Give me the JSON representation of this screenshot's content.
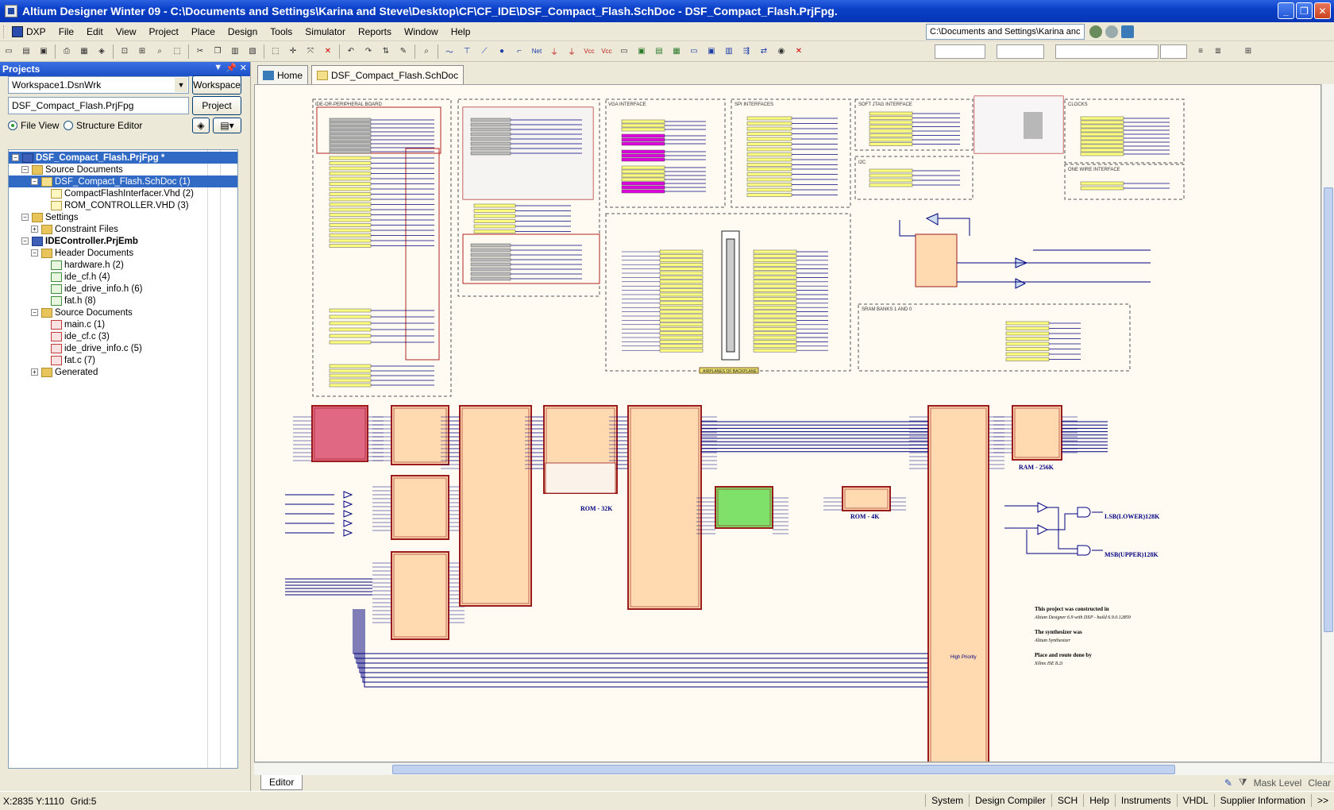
{
  "window": {
    "title": "Altium Designer Winter 09 - C:\\Documents and Settings\\Karina and Steve\\Desktop\\CF\\CF_IDE\\DSF_Compact_Flash.SchDoc - DSF_Compact_Flash.PrjFpg.",
    "min": "_",
    "max": "❐",
    "close": "✕"
  },
  "menu": {
    "items": [
      "DXP",
      "File",
      "Edit",
      "View",
      "Project",
      "Place",
      "Design",
      "Tools",
      "Simulator",
      "Reports",
      "Window",
      "Help"
    ],
    "path": "C:\\Documents and Settings\\Karina anc"
  },
  "projects_panel": {
    "title": "Projects",
    "workspace_value": "Workspace1.DsnWrk",
    "workspace_btn": "Workspace",
    "project_value": "DSF_Compact_Flash.PrjFpg",
    "project_btn": "Project",
    "file_view": "File View",
    "structure_editor": "Structure Editor",
    "tree": [
      {
        "label": "DSF_Compact_Flash.PrjFpg *",
        "level": 0,
        "exp": "-",
        "icon": "proj",
        "bold": true,
        "selected": true
      },
      {
        "label": "Source Documents",
        "level": 1,
        "exp": "-",
        "icon": "folder"
      },
      {
        "label": "DSF_Compact_Flash.SchDoc (1)",
        "level": 2,
        "exp": "-",
        "icon": "sch",
        "selected": true
      },
      {
        "label": "CompactFlashInterfacer.Vhd (2)",
        "level": 3,
        "exp": "",
        "icon": "vhd"
      },
      {
        "label": "ROM_CONTROLLER.VHD (3)",
        "level": 3,
        "exp": "",
        "icon": "vhd"
      },
      {
        "label": "Settings",
        "level": 1,
        "exp": "-",
        "icon": "folder"
      },
      {
        "label": "Constraint Files",
        "level": 2,
        "exp": "+",
        "icon": "folder"
      },
      {
        "label": "IDEController.PrjEmb",
        "level": 1,
        "exp": "-",
        "icon": "proj",
        "bold": true
      },
      {
        "label": "Header Documents",
        "level": 2,
        "exp": "-",
        "icon": "folder"
      },
      {
        "label": "hardware.h (2)",
        "level": 3,
        "exp": "",
        "icon": "h"
      },
      {
        "label": "ide_cf.h (4)",
        "level": 3,
        "exp": "",
        "icon": "h"
      },
      {
        "label": "ide_drive_info.h (6)",
        "level": 3,
        "exp": "",
        "icon": "h"
      },
      {
        "label": "fat.h (8)",
        "level": 3,
        "exp": "",
        "icon": "h"
      },
      {
        "label": "Source Documents",
        "level": 2,
        "exp": "-",
        "icon": "folder"
      },
      {
        "label": "main.c (1)",
        "level": 3,
        "exp": "",
        "icon": "c"
      },
      {
        "label": "ide_cf.c (3)",
        "level": 3,
        "exp": "",
        "icon": "c"
      },
      {
        "label": "ide_drive_info.c (5)",
        "level": 3,
        "exp": "",
        "icon": "c"
      },
      {
        "label": "fat.c (7)",
        "level": 3,
        "exp": "",
        "icon": "c"
      },
      {
        "label": "Generated",
        "level": 2,
        "exp": "+",
        "icon": "folder"
      }
    ]
  },
  "doc_tabs": [
    "Home",
    "DSF_Compact_Flash.SchDoc"
  ],
  "schematic": {
    "sections": {
      "ide": "IDE-OR-PERIPHERAL BOARD",
      "vga": "VGA INTERFACE",
      "spi": "SPI INTERFACES",
      "jtag": "SOFT JTAG INTERFACE",
      "clocks": "CLOCKS",
      "i2c": "I2C",
      "onewire": "ONE WIRE INTERFACE",
      "sram": "SRAM BANKS 1 AND 0",
      "backplane": "AIRPLANES OF BACKPLANE"
    },
    "labels": {
      "rom32": "ROM - 32K",
      "rom4": "ROM - 4K",
      "ram": "RAM - 256K",
      "lsb": "LSB(LOWER)128K",
      "msb": "MSB(UPPER)128K",
      "high_priority": "High Priority"
    },
    "notes": [
      "This project was constructed in",
      "Altium Designer 6.9 with DXP - build 6.9.0.12859",
      "The synthesizer was",
      "Altium Synthesizer",
      "Place and route done by",
      "Xilinx ISE 8.2i"
    ],
    "colors": {
      "orange": "#ffd9b0",
      "pink": "#e06882",
      "green": "#7fe06a",
      "yellow": "#ffff80",
      "magenta": "#e000e0",
      "wire": "#00007f",
      "border": "#9c1c1c"
    }
  },
  "editor_tab": "Editor",
  "editor_right": [
    "Mask Level",
    "Clear"
  ],
  "status": {
    "coords": "X:2835 Y:1110",
    "grid": "Grid:5",
    "tabs": [
      "System",
      "Design Compiler",
      "SCH",
      "Help",
      "Instruments",
      "VHDL",
      "Supplier Information",
      ">>"
    ]
  }
}
